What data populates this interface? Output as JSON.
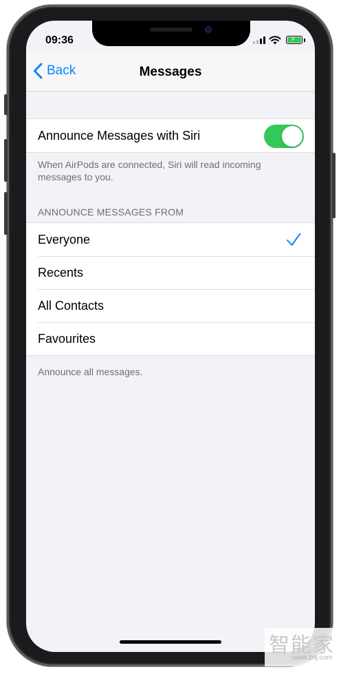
{
  "status_bar": {
    "time": "09:36"
  },
  "nav": {
    "back_label": "Back",
    "title": "Messages"
  },
  "siri_setting": {
    "label": "Announce Messages with Siri",
    "enabled": true,
    "description": "When AirPods are connected, Siri will read incoming messages to you."
  },
  "announce_from": {
    "header": "ANNOUNCE MESSAGES FROM",
    "options": [
      {
        "label": "Everyone",
        "selected": true
      },
      {
        "label": "Recents",
        "selected": false
      },
      {
        "label": "All Contacts",
        "selected": false
      },
      {
        "label": "Favourites",
        "selected": false
      }
    ],
    "footer": "Announce all messages."
  },
  "watermark": {
    "chars": "智能家",
    "url": "www.znj.com"
  },
  "colors": {
    "accent": "#0a84ff",
    "toggle_on": "#34c759",
    "background": "#f2f2f7",
    "secondary_text": "#6d6d72"
  },
  "icons": [
    "back-chevron-icon",
    "cell-signal-icon",
    "wifi-icon",
    "battery-charging-icon",
    "checkmark-icon"
  ]
}
